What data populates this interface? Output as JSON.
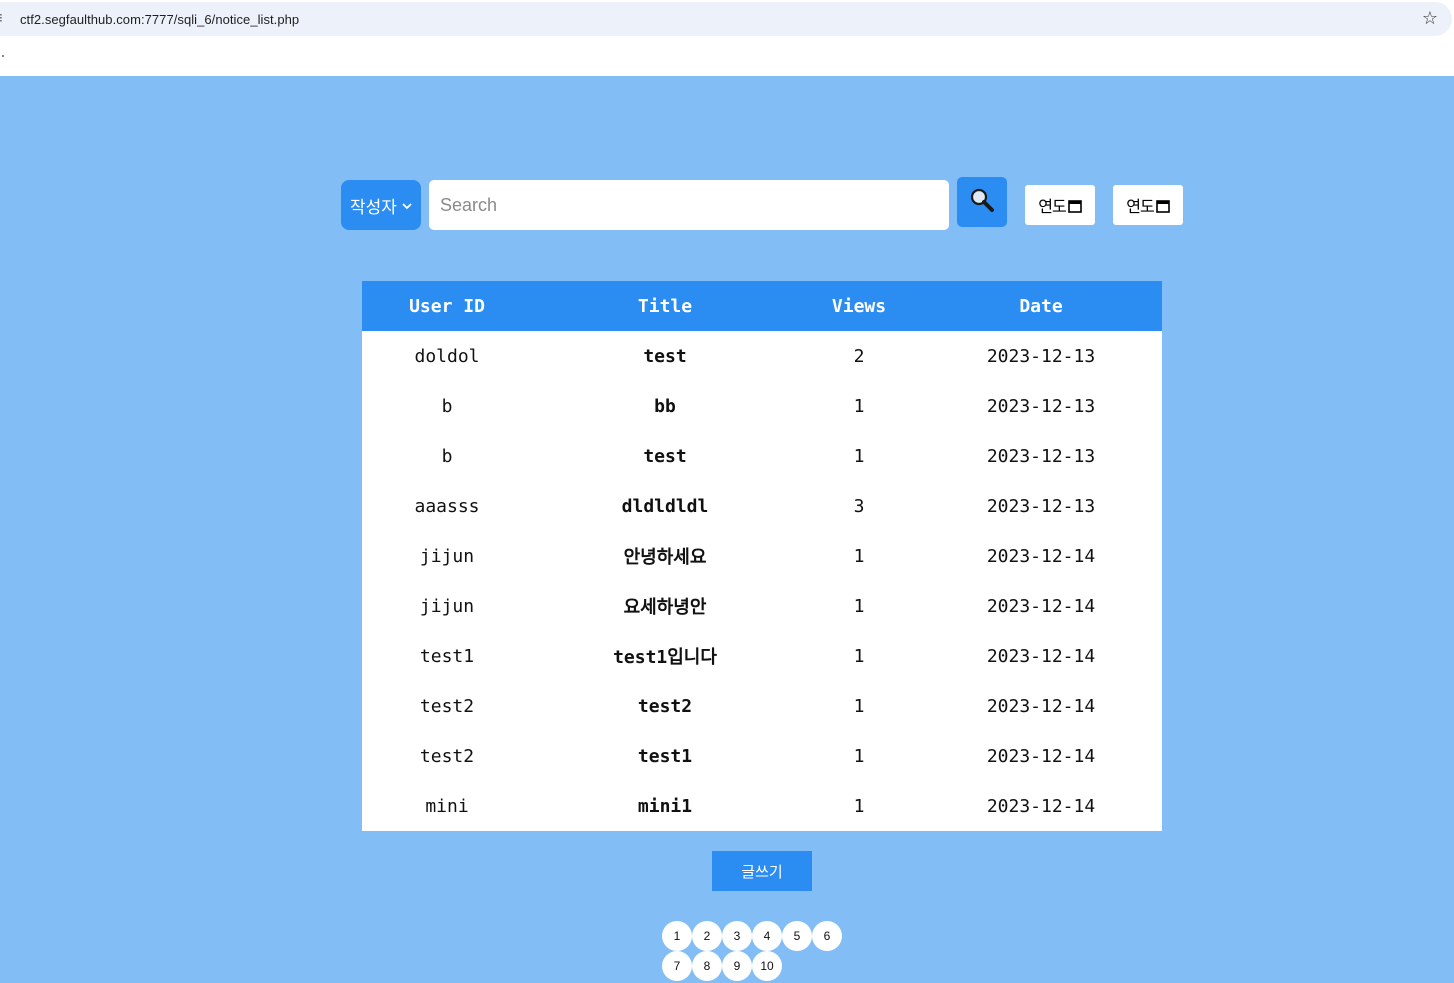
{
  "browser": {
    "url": "ctf2.segfaulthub.com:7777/sqli_6/notice_list.php"
  },
  "search": {
    "field_select": "작성자",
    "placeholder": "Search",
    "date_from_placeholder": "연도",
    "date_to_placeholder": "연도"
  },
  "table": {
    "headers": [
      "User ID",
      "Title",
      "Views",
      "Date"
    ],
    "rows": [
      {
        "user": "doldol",
        "title": "test",
        "views": "2",
        "date": "2023-12-13"
      },
      {
        "user": "b",
        "title": "bb",
        "views": "1",
        "date": "2023-12-13"
      },
      {
        "user": "b",
        "title": "test",
        "views": "1",
        "date": "2023-12-13"
      },
      {
        "user": "aaasss",
        "title": "dldldldl",
        "views": "3",
        "date": "2023-12-13"
      },
      {
        "user": "jijun",
        "title": "안녕하세요",
        "views": "1",
        "date": "2023-12-14"
      },
      {
        "user": "jijun",
        "title": "요세하녕안",
        "views": "1",
        "date": "2023-12-14"
      },
      {
        "user": "test1",
        "title": "test1입니다",
        "views": "1",
        "date": "2023-12-14"
      },
      {
        "user": "test2",
        "title": "test2",
        "views": "1",
        "date": "2023-12-14"
      },
      {
        "user": "test2",
        "title": "test1",
        "views": "1",
        "date": "2023-12-14"
      },
      {
        "user": "mini",
        "title": "mini1",
        "views": "1",
        "date": "2023-12-14"
      }
    ]
  },
  "write_button": "글쓰기",
  "pagination": [
    "1",
    "2",
    "3",
    "4",
    "5",
    "6",
    "7",
    "8",
    "9",
    "10"
  ],
  "colors": {
    "background": "#83bdf5",
    "accent": "#2b8df2"
  },
  "icons": {
    "search": "magnifier-icon",
    "calendar": "calendar-icon",
    "bookmark": "star-icon"
  }
}
